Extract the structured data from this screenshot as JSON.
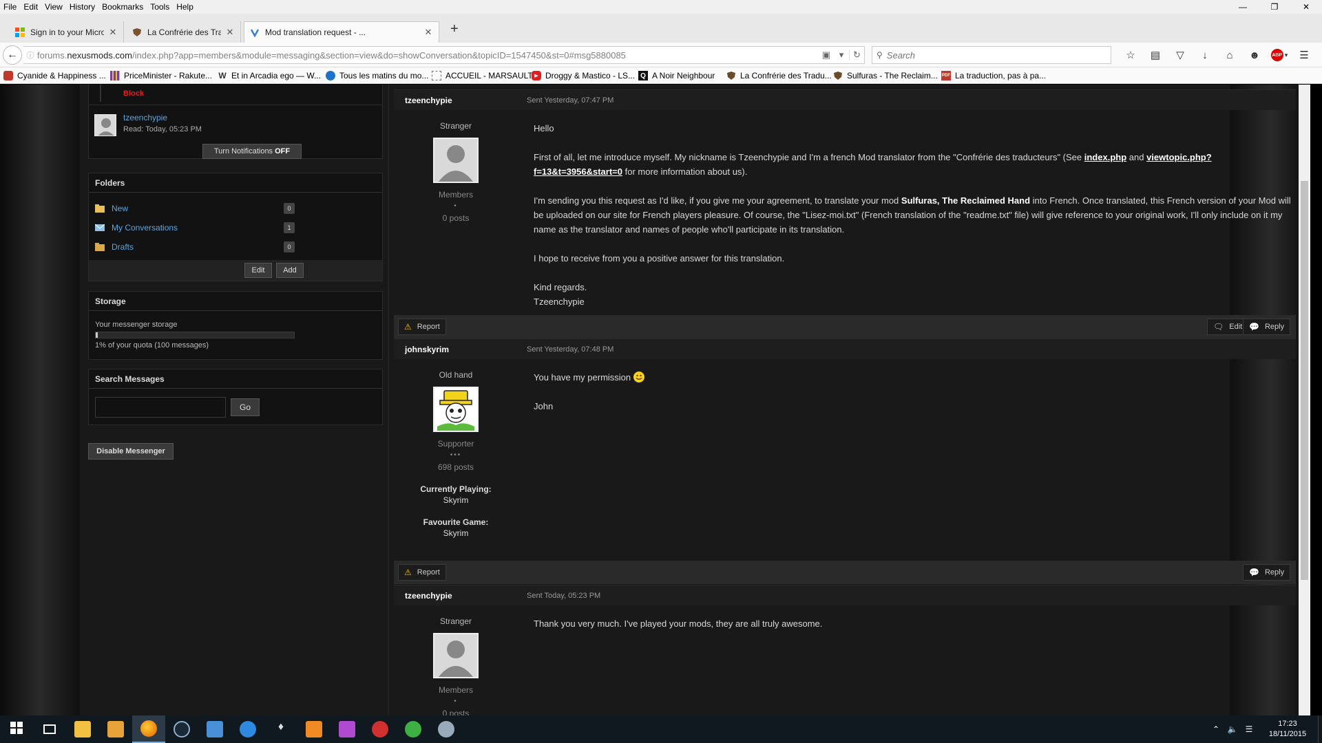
{
  "menu": [
    "File",
    "Edit",
    "View",
    "History",
    "Bookmarks",
    "Tools",
    "Help"
  ],
  "window_controls": [
    "—",
    "❐",
    "✕"
  ],
  "tabs": [
    {
      "label": "Sign in to your Microsoft ...",
      "icon": "microsoft-icon"
    },
    {
      "label": "La Confrérie des Traducte...",
      "icon": "shield-icon"
    },
    {
      "label": "Mod translation request - ...",
      "icon": "nexus-icon"
    }
  ],
  "tab_close": "✕",
  "new_tab": "+",
  "url": {
    "prefix": "forums.",
    "domain": "nexusmods.com",
    "path": "/index.php?app=members&module=messaging&section=view&do=showConversation&topicID=1547450&st=0#msg5880085"
  },
  "search": {
    "placeholder": "Search"
  },
  "bookmarks": [
    {
      "label": "Cyanide & Happiness ...",
      "color": "#c0392b"
    },
    {
      "label": "PriceMinister - Rakute...",
      "color": "#7b3fa0"
    },
    {
      "label": "Et in Arcadia ego — W...",
      "color": "#333333",
      "glyph": "W"
    },
    {
      "label": "Tous les matins du mo...",
      "color": "#1a73c8"
    },
    {
      "label": "ACCUEIL - MARSAULT",
      "color": "#777777"
    },
    {
      "label": "Droggy & Mastico - LS...",
      "color": "#e02020"
    },
    {
      "label": "A Noir Neighbour",
      "color": "#111111",
      "glyph": "Q"
    },
    {
      "label": "La Confrérie des Tradu...",
      "color": "#6b4a2a"
    },
    {
      "label": "Sulfuras - The Reclaim...",
      "color": "#6b4a2a"
    },
    {
      "label": "La traduction, pas à pa...",
      "color": "#c0392b",
      "glyph": "PDF"
    }
  ],
  "sidebar": {
    "block_label": "Block",
    "participant": {
      "name": "tzeenchypie",
      "read": "Read: Today, 05:23 PM"
    },
    "notifications_btn": "Turn Notifications",
    "notifications_state": "OFF",
    "folders_title": "Folders",
    "folders": [
      {
        "label": "New",
        "count": "0"
      },
      {
        "label": "My Conversations",
        "count": "1"
      },
      {
        "label": "Drafts",
        "count": "0"
      }
    ],
    "edit_btn": "Edit",
    "add_btn": "Add",
    "storage_title": "Storage",
    "storage_label": "Your messenger storage",
    "storage_quota": "1% of your quota (100 messages)",
    "storage_used": 0.01,
    "search_title": "Search Messages",
    "go_btn": "Go",
    "disable_btn": "Disable Messenger"
  },
  "messages": [
    {
      "author": "tzeenchypie",
      "date": "Sent Yesterday, 07:47 PM",
      "rank": "Stranger",
      "group": "Members",
      "pips": "•",
      "posts": "0 posts",
      "greeting": "Hello",
      "p1_a": "First of all, let me introduce myself. My nickname is Tzeenchypie and I'm a french Mod translator from the \"Confrérie des traducteurs\" (See ",
      "link1": "index.php",
      "p1_b": " and ",
      "link2": "viewtopic.php?f=13&t=3956&start=0",
      "p1_c": " for more information about us).",
      "p2_a": "I'm sending you this request as I'd like, if you give me your agreement, to translate your mod ",
      "p2_bold": "Sulfuras, The Reclaimed Hand",
      "p2_b": " into French. Once translated, this French version of your Mod will be uploaded on our site for French players pleasure. Of course, the \"Lisez-moi.txt\" (French translation of the \"readme.txt\" file) will give reference to your original work, I'll only include on it my name as the translator and names of people who'll participate in its translation.",
      "p3": "I hope to receive from you a positive answer for this translation.",
      "p4a": "Kind regards.",
      "p4b": "Tzeenchypie",
      "report": "Report",
      "edit": "Edit",
      "reply": "Reply"
    },
    {
      "author": "johnskyrim",
      "date": "Sent Yesterday, 07:48 PM",
      "rank": "Old hand",
      "group": "Supporter",
      "pips": "•••",
      "posts": "698 posts",
      "playing_label": "Currently Playing:",
      "playing_value": "Skyrim",
      "fav_label": "Favourite Game:",
      "fav_value": "Skyrim",
      "line1": "You have my permission",
      "line2": "John",
      "report": "Report",
      "reply": "Reply"
    },
    {
      "author": "tzeenchypie",
      "date": "Sent Today, 05:23 PM",
      "rank": "Stranger",
      "group": "Members",
      "pips": "•",
      "posts": "0 posts",
      "line1": "Thank you very much. I've played your mods, they are all truly awesome."
    }
  ],
  "taskbar": {
    "time": "17:23",
    "date": "18/11/2015"
  },
  "colors": {
    "link": "#5aa6e3",
    "warn": "#f2c100",
    "block": "#e02020"
  }
}
